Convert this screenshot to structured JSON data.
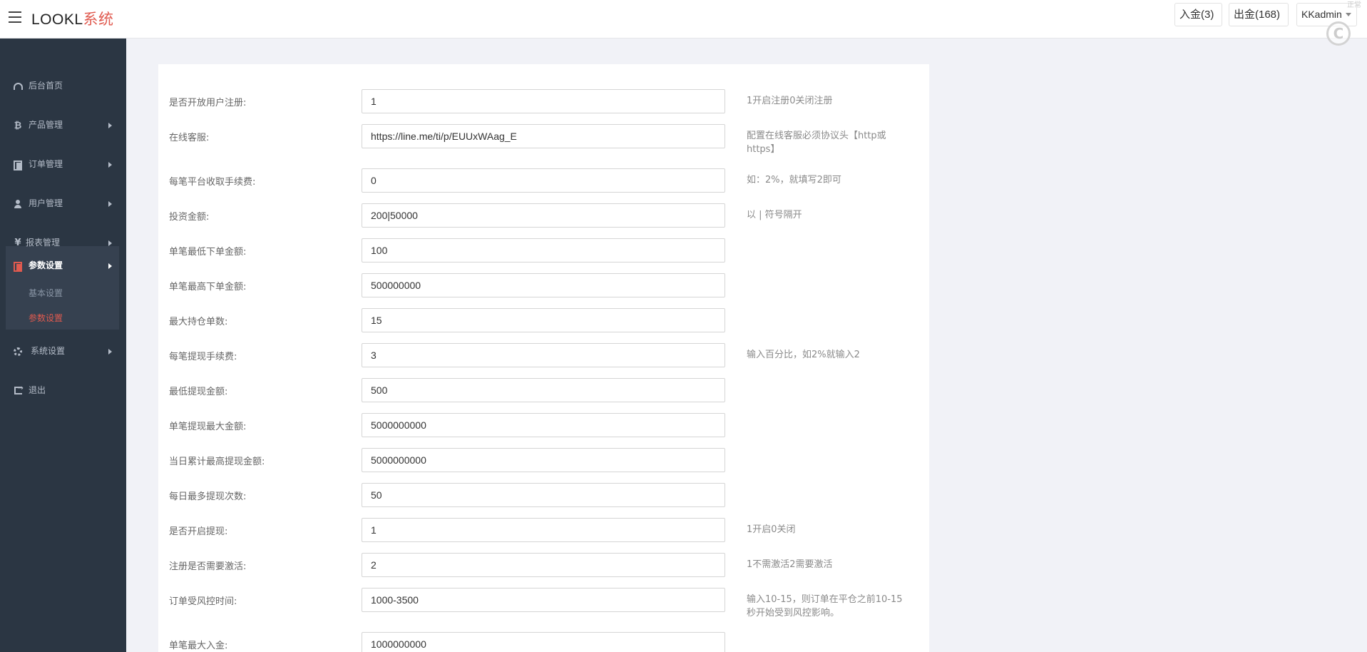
{
  "app": {
    "logo_main": "LOOKL",
    "logo_accent": "系统",
    "deposit_label": "入金(3)",
    "withdraw_label": "出金(168)",
    "user_label": "KKadmin",
    "corner_text": "正常"
  },
  "sidebar": {
    "items": [
      {
        "label": "后台首页",
        "icon": "dashboard-icon"
      },
      {
        "label": "产品管理",
        "icon": "bitcoin-icon"
      },
      {
        "label": "订单管理",
        "icon": "copy-icon"
      },
      {
        "label": "用户管理",
        "icon": "user-icon"
      },
      {
        "label": "报表管理",
        "icon": "yen-icon"
      },
      {
        "label": "参数设置",
        "icon": "copy-icon"
      },
      {
        "label": "系统设置",
        "icon": "gears-icon"
      },
      {
        "label": "退出",
        "icon": "sign-out-icon"
      }
    ],
    "sub_items": [
      "基本设置",
      "参数设置"
    ]
  },
  "form": {
    "rows": [
      {
        "label": "是否开放用户注册:",
        "value": "1",
        "help": "1开启注册0关闭注册"
      },
      {
        "label": "在线客服:",
        "value": "https://line.me/ti/p/EUUxWAag_E",
        "help": "配置在线客服必须协议头【http或https】"
      },
      {
        "label": "每笔平台收取手续费:",
        "value": "0",
        "help": "如：2%，就填写2即可"
      },
      {
        "label": "投资金额:",
        "value": "200|50000",
        "help": "以 | 符号隔开"
      },
      {
        "label": "单笔最低下单金额:",
        "value": "100",
        "help": ""
      },
      {
        "label": "单笔最高下单金额:",
        "value": "500000000",
        "help": ""
      },
      {
        "label": "最大持仓单数:",
        "value": "15",
        "help": ""
      },
      {
        "label": "每笔提现手续费:",
        "value": "3",
        "help": "输入百分比，如2%就输入2"
      },
      {
        "label": "最低提现金额:",
        "value": "500",
        "help": ""
      },
      {
        "label": "单笔提现最大金额:",
        "value": "5000000000",
        "help": ""
      },
      {
        "label": "当日累计最高提现金额:",
        "value": "5000000000",
        "help": ""
      },
      {
        "label": "每日最多提现次数:",
        "value": "50",
        "help": ""
      },
      {
        "label": "是否开启提现:",
        "value": "1",
        "help": "1开启0关闭"
      },
      {
        "label": "注册是否需要激活:",
        "value": "2",
        "help": "1不需激活2需要激活"
      },
      {
        "label": "订单受风控时间:",
        "value": "1000-3500",
        "help": "输入10-15，则订单在平仓之前10-15秒开始受到风控影响。"
      },
      {
        "label": "单笔最大入金:",
        "value": "1000000000",
        "help": ""
      }
    ]
  }
}
